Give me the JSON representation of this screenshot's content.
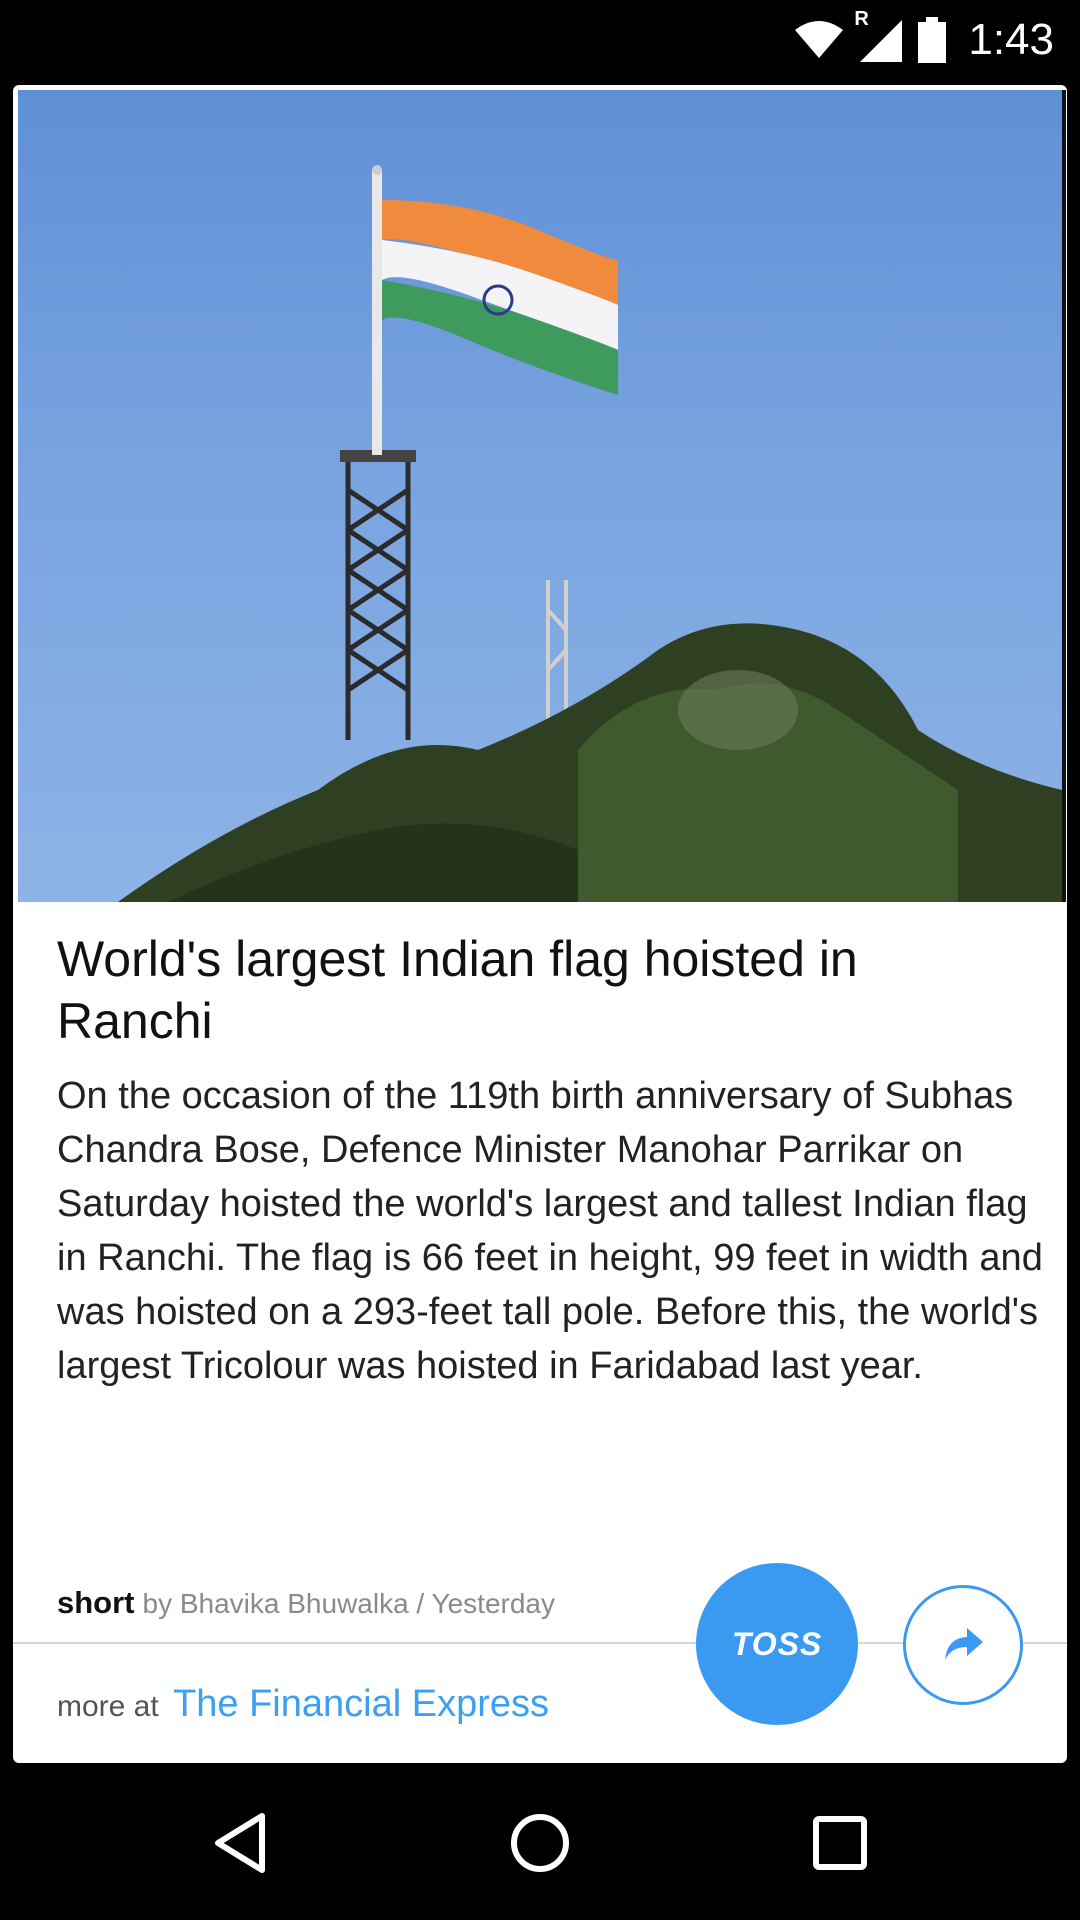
{
  "status_bar": {
    "time": "1:43",
    "roaming_label": "R",
    "icons": [
      "wifi-icon",
      "signal-icon",
      "battery-icon"
    ]
  },
  "article": {
    "image": "photo of a large Indian tricolour flag on a tall pole atop a wooded hill",
    "title": "World's largest Indian flag hoisted in Ranchi",
    "body": "On the occasion of the 119th birth anniversary of Subhas Chandra Bose, Defence Minister Manohar Parrikar on Saturday hoisted the world's largest and tallest Indian flag in Ranchi. The flag is 66 feet in height, 99 feet in width and was hoisted on a 293-feet tall pole. Before this, the world's largest Tricolour was hoisted in Faridabad last year.",
    "brand": "short",
    "byline": "by Bhavika Bhuwalka / Yesterday",
    "more_at_label": "more at",
    "source": "The Financial Express"
  },
  "actions": {
    "toss_label": "TOSS",
    "share_icon": "share-icon"
  },
  "nav": {
    "icons": [
      "back-icon",
      "home-icon",
      "recents-icon"
    ]
  },
  "colors": {
    "accent": "#3a9af2",
    "link": "#3c9ff0"
  }
}
